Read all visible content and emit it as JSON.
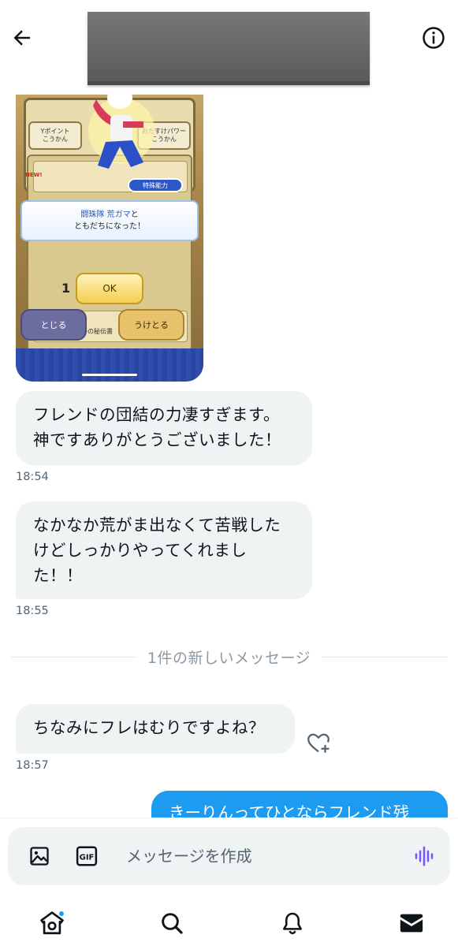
{
  "header": {
    "back_label": "",
    "info_label": ""
  },
  "game_image": {
    "tab_left": "Yポイント\nこうかん",
    "tab_right": "おたすけパワー\nこうかん",
    "new_badge": "NEW!",
    "skill_badge": "特殊能力",
    "dialog_line1_prefix": "",
    "dialog_name": "闘珠隊 荒ガマ",
    "dialog_line1_suffix": "と",
    "dialog_line2": "ともだちになった！",
    "row_text": "神ひっさつの秘伝書",
    "count": "1",
    "ok_label": "OK",
    "close_label": "とじる",
    "receive_label": "うけとる"
  },
  "messages": [
    {
      "lines": [
        "フレンドの団結の力凄すぎます。",
        "神ですありがとうございました！"
      ],
      "time": "18:54"
    },
    {
      "lines": [
        "なかなか荒がま出なくて苦戦した",
        "けどしっかりやってくれまし",
        "た！！"
      ],
      "time": "18:55"
    },
    {
      "lines": [
        "ちなみにフレはむりですよね？"
      ],
      "time": "18:57"
    }
  ],
  "divider_text": "1件の新しいメッセージ",
  "outgoing": {
    "text": "きーりんってひとならフレンド残"
  },
  "composer": {
    "placeholder": "メッセージを作成",
    "gif_label": "GIF"
  },
  "nav": {
    "items": [
      "home-icon",
      "search-icon",
      "notifications-icon",
      "messages-icon"
    ],
    "accent": "#1d9bf0"
  },
  "colors": {
    "bubble_in": "#eff3f4",
    "bubble_out": "#1d9bf0",
    "timestamp": "#536471",
    "redaction": "#6e6e6e"
  }
}
